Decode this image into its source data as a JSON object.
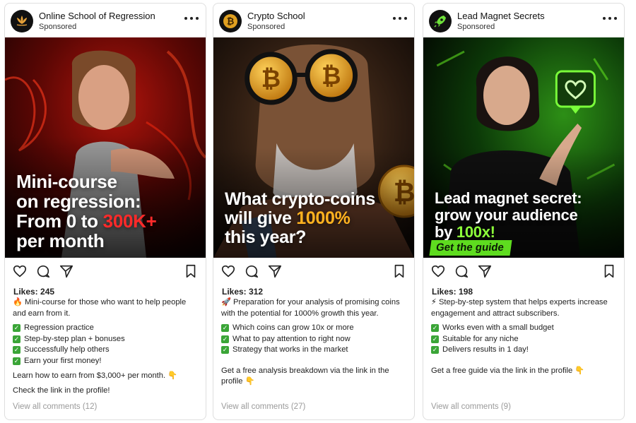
{
  "posts": [
    {
      "brand": "Online School of Regression",
      "sponsored": "Sponsored",
      "avatar_icon": "lotus-icon",
      "headline_line1": "Mini-course",
      "headline_line2": "on regression:",
      "headline_line3a": "From 0 to ",
      "headline_line3b": "300K+",
      "headline_line4": "per month",
      "likes": "Likes: 245",
      "intro": "🔥 Mini-course for those who want to help people and earn from it.",
      "checklist": [
        "Regression practice",
        "Step-by-step plan + bonuses",
        "Successfully help others",
        "Earn your first money!"
      ],
      "extra": "Learn how to earn from $3,000+ per month. 👇",
      "cta": "Check the link in the profile!",
      "comments": "View all comments (12)",
      "accent": "#ff2a2a"
    },
    {
      "brand": "Crypto School",
      "sponsored": "Sponsored",
      "avatar_icon": "bitcoin-icon",
      "headline_line1": "What crypto-coins",
      "headline_line2a": "will give ",
      "headline_line2b": "1000%",
      "headline_line3": "this year?",
      "likes": "Likes: 312",
      "intro": "🚀 Preparation for your analysis of promising coins with the potential for 1000% growth this year.",
      "checklist": [
        "Which coins can grow 10x or more",
        "What to pay attention to right now",
        "Strategy that works in the market"
      ],
      "cta": "Get a free analysis breakdown via the link in the profile 👇",
      "comments": "View all comments (27)",
      "accent": "#ffb21f"
    },
    {
      "brand": "Lead Magnet Secrets",
      "sponsored": "Sponsored",
      "avatar_icon": "rocket-icon",
      "headline_line1": "Lead magnet secret:",
      "headline_line2": "grow your audience",
      "headline_line3a": "by ",
      "headline_line3b": "100x!",
      "badge": "Get the guide",
      "likes": "Likes: 198",
      "intro": "⚡ Step-by-step system that helps experts increase engagement and attract subscribers.",
      "checklist": [
        "Works even with a small budget",
        "Suitable for any niche",
        "Delivers results in 1 day!"
      ],
      "cta": "Get a free guide via the link in the profile 👇",
      "comments": "View all comments (9)",
      "accent": "#5edc1f"
    }
  ]
}
